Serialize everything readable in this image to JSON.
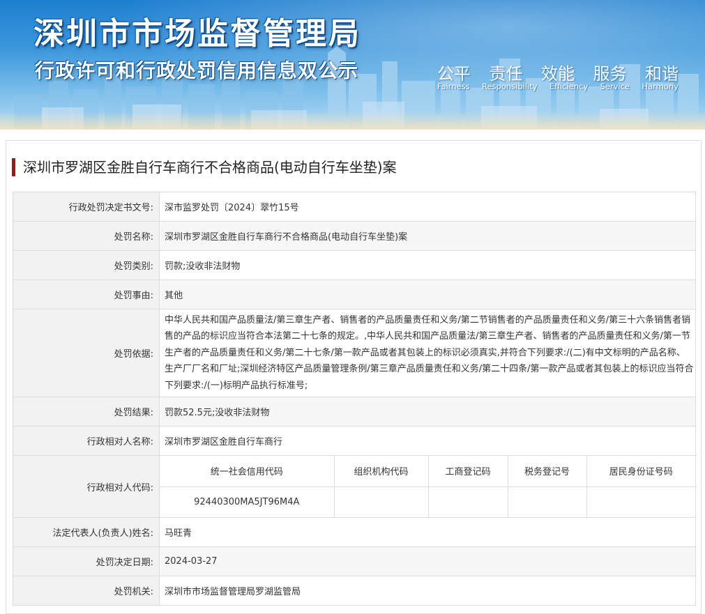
{
  "banner": {
    "title": "深圳市市场监督管理局",
    "subtitle": "行政许可和行政处罚信用信息双公示",
    "slogans_cn": [
      "公平",
      "责任",
      "效能",
      "服务",
      "和谐"
    ],
    "slogans_en": [
      "Fairness",
      "Responsibility",
      "Efficiency",
      "Service",
      "Harmony"
    ]
  },
  "case": {
    "title": "深圳市罗湖区金胜自行车商行不合格商品(电动自行车坐垫)案"
  },
  "details": {
    "decision_number": {
      "label": "行政处罚决定书文号:",
      "value": "深市监罗处罚〔2024〕翠竹15号"
    },
    "penalty_name": {
      "label": "处罚名称:",
      "value": "深圳市罗湖区金胜自行车商行不合格商品(电动自行车坐垫)案"
    },
    "penalty_category": {
      "label": "处罚类别:",
      "value": "罚款;没收非法财物"
    },
    "penalty_reason": {
      "label": "处罚事由:",
      "value": "其他"
    },
    "penalty_basis": {
      "label": "处罚依据:",
      "value": "中华人民共和国产品质量法/第三章生产者、销售者的产品质量责任和义务/第二节销售者的产品质量责任和义务/第三十六条销售者销售的产品的标识应当符合本法第二十七条的规定。,中华人民共和国产品质量法/第三章生产者、销售者的产品质量责任和义务/第一节生产者的产品质量责任和义务/第二十七条/第一款产品或者其包装上的标识必须真实,并符合下列要求:/(二)有中文标明的产品名称、生产厂厂名和厂址;深圳经济特区产品质量管理条例/第三章产品质量责任和义务/第二十四条/第一款产品或者其包装上的标识应当符合下列要求:/(一)标明产品执行标准号;"
    },
    "penalty_result": {
      "label": "处罚结果:",
      "value": "罚款52.5元;没收非法财物"
    },
    "party_name": {
      "label": "行政相对人名称:",
      "value": "深圳市罗湖区金胜自行车商行"
    },
    "party_code": {
      "label": "行政相对人代码:",
      "headers": [
        "统一社会信用代码",
        "组织机构代码",
        "工商登记码",
        "税务登记号",
        "居民身份证号码"
      ],
      "values": [
        "92440300MA5JT96M4A",
        "",
        "",
        "",
        ""
      ]
    },
    "legal_rep": {
      "label": "法定代表人(负责人)姓名:",
      "value": "马旺青"
    },
    "decision_date": {
      "label": "处罚决定日期:",
      "value": "2024-03-27"
    },
    "authority": {
      "label": "处罚机关:",
      "value": "深圳市市场监督管理局罗湖监管局"
    }
  },
  "colors": {
    "title_bar_accent": "#a01818",
    "label_background": "#f2f2f2",
    "banner_sky": "#3c97dc"
  }
}
